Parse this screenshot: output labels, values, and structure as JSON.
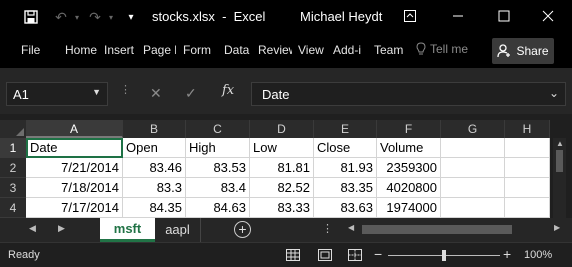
{
  "window": {
    "title": "stocks.xlsx  -  Excel",
    "user": "Michael Heydt",
    "icons": [
      "save-icon",
      "undo-icon",
      "redo-icon",
      "customize-icon",
      "restore-ribbon-icon",
      "minimize-icon",
      "maximize-icon",
      "close-icon"
    ]
  },
  "ribbon": {
    "tabs": [
      "File",
      "Home",
      "Insert",
      "Page l",
      "Form",
      "Data",
      "Review",
      "View",
      "Add-i",
      "Team"
    ],
    "tell_me": "Tell me",
    "share": "Share"
  },
  "formula_bar": {
    "name_box": "A1",
    "fx": "fx",
    "value": "Date"
  },
  "grid": {
    "columns": [
      "A",
      "B",
      "C",
      "D",
      "E",
      "F",
      "G",
      "H"
    ],
    "rows": [
      "1",
      "2",
      "3",
      "4"
    ],
    "cells": [
      [
        "Date",
        "Open",
        "High",
        "Low",
        "Close",
        "Volume",
        "",
        ""
      ],
      [
        "7/21/2014",
        "83.46",
        "83.53",
        "81.81",
        "81.93",
        "2359300",
        "",
        ""
      ],
      [
        "7/18/2014",
        "83.3",
        "83.4",
        "82.52",
        "83.35",
        "4020800",
        "",
        ""
      ],
      [
        "7/17/2014",
        "84.35",
        "84.63",
        "83.33",
        "83.63",
        "1974000",
        "",
        ""
      ]
    ],
    "active_cell": "A1"
  },
  "sheets": {
    "tabs": [
      "msft",
      "aapl"
    ],
    "active": "msft"
  },
  "status": {
    "text": "Ready",
    "zoom_out": "−",
    "zoom_in": "+",
    "zoom": "100%",
    "zoom_fraction": 0.5
  },
  "colors": {
    "accent": "#217346",
    "active_border": "#1e7145"
  }
}
